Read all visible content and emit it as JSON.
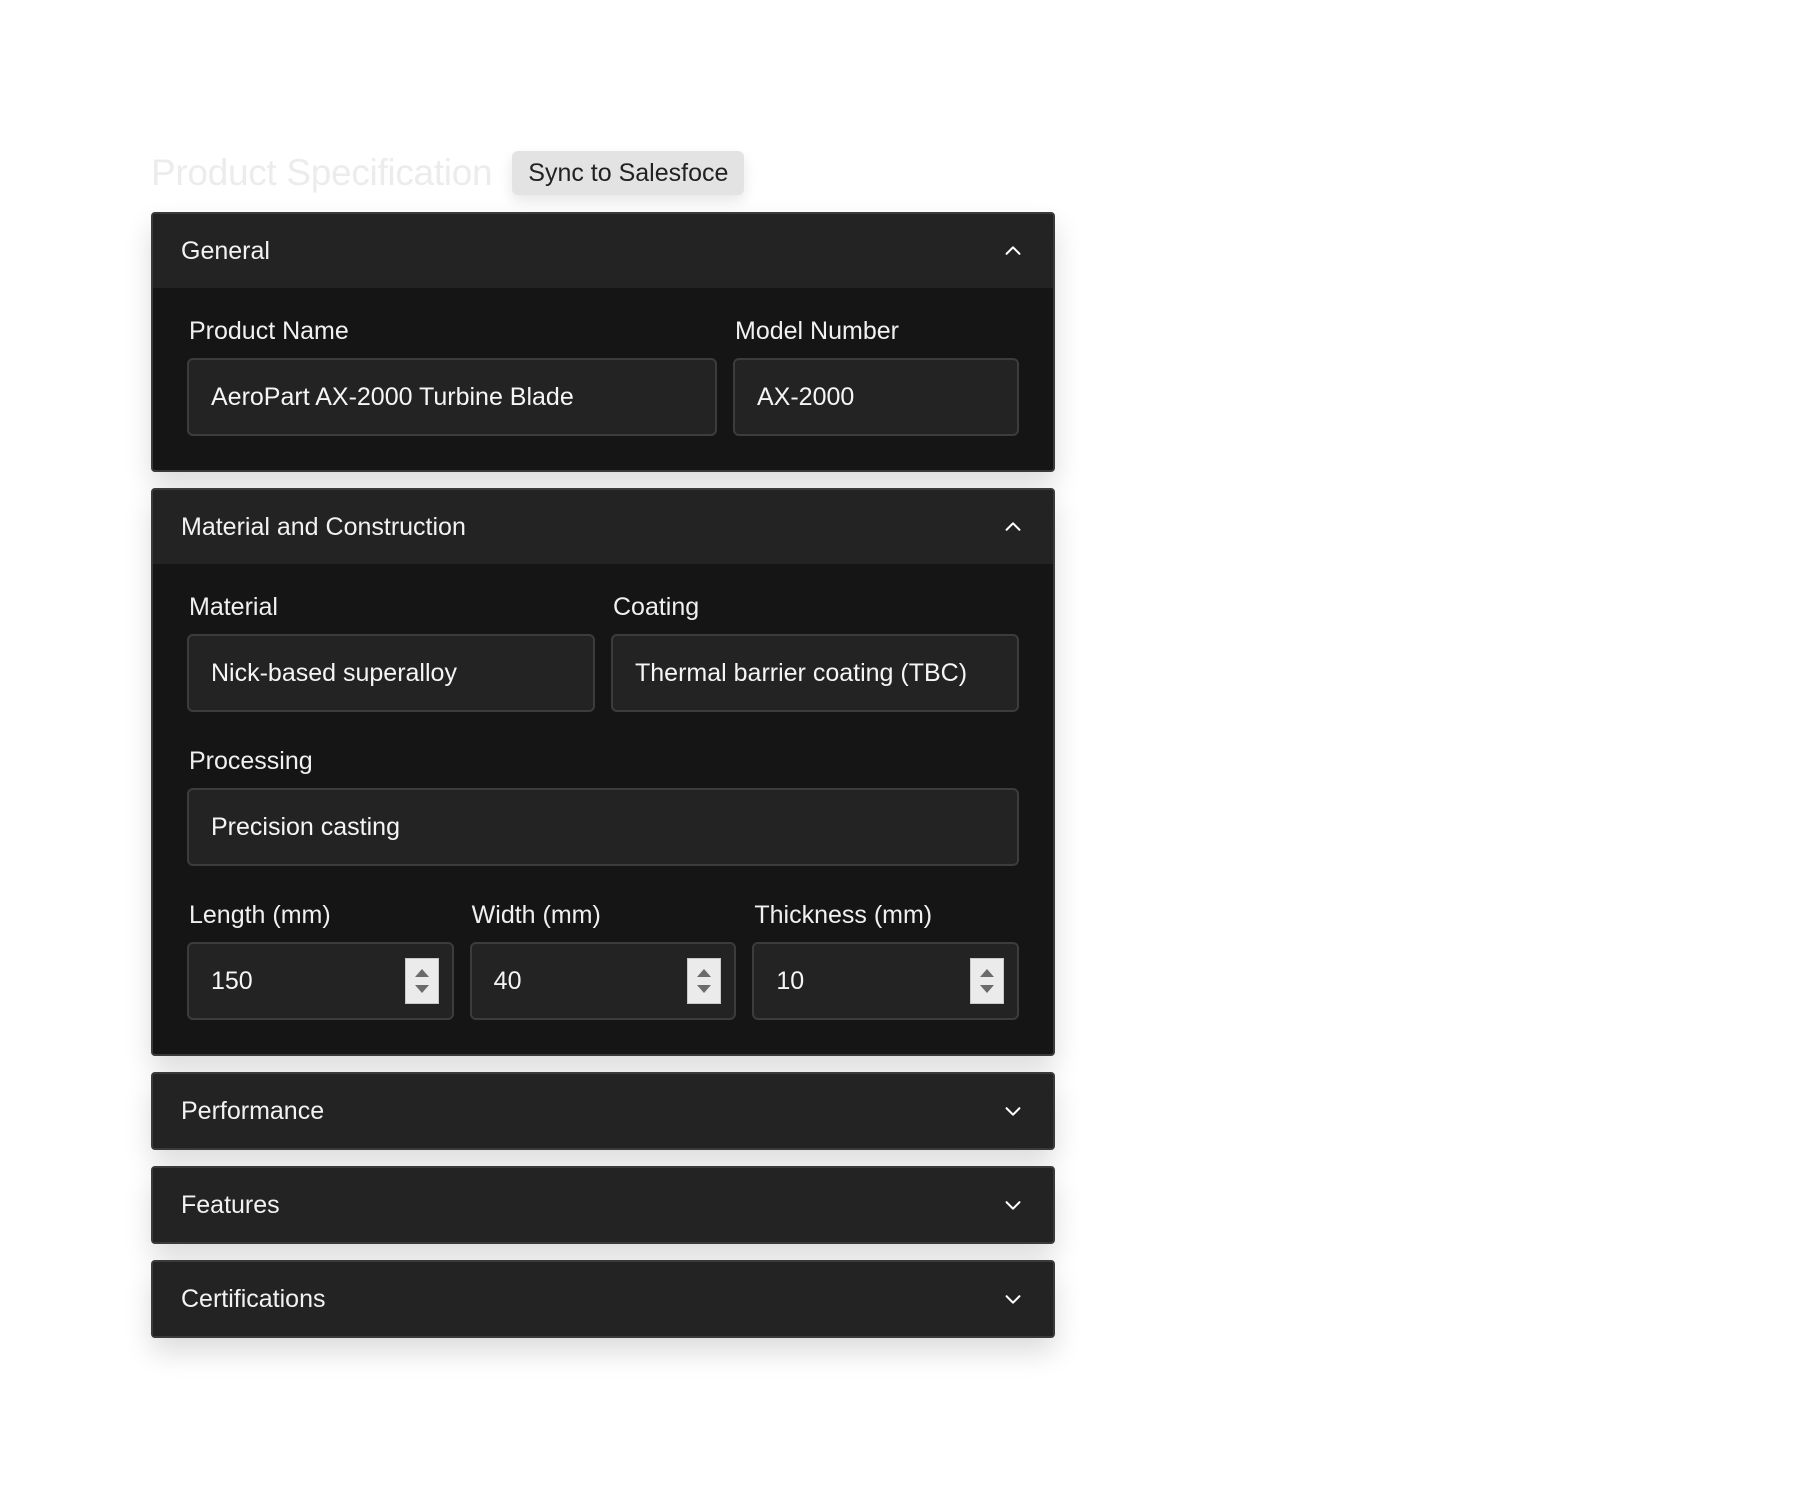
{
  "header": {
    "title": "Product Specification",
    "sync_button_label": "Sync to Salesfoce"
  },
  "sections": {
    "general": {
      "title": "General",
      "expanded": true,
      "chevron": "chevron-up-icon",
      "fields": {
        "product_name": {
          "label": "Product Name",
          "value": "AeroPart AX-2000 Turbine Blade"
        },
        "model_number": {
          "label": "Model Number",
          "value": "AX-2000"
        }
      }
    },
    "material": {
      "title": "Material and Construction",
      "expanded": true,
      "chevron": "chevron-up-icon",
      "fields": {
        "material": {
          "label": "Material",
          "value": "Nick-based superalloy"
        },
        "coating": {
          "label": "Coating",
          "value": "Thermal barrier coating (TBC)"
        },
        "processing": {
          "label": "Processing",
          "value": "Precision casting"
        },
        "length": {
          "label": "Length (mm)",
          "value": "150"
        },
        "width": {
          "label": "Width (mm)",
          "value": "40"
        },
        "thickness": {
          "label": "Thickness (mm)",
          "value": "10"
        }
      }
    },
    "performance": {
      "title": "Performance",
      "expanded": false,
      "chevron": "chevron-down-icon"
    },
    "features": {
      "title": "Features",
      "expanded": false,
      "chevron": "chevron-down-icon"
    },
    "certifications": {
      "title": "Certifications",
      "expanded": false,
      "chevron": "chevron-down-icon"
    }
  },
  "colors": {
    "panel_header_bg": "#232323",
    "panel_body_bg": "#151515",
    "input_bg": "#232323",
    "title_text": "#ececec",
    "button_bg": "#e3e3e3"
  }
}
